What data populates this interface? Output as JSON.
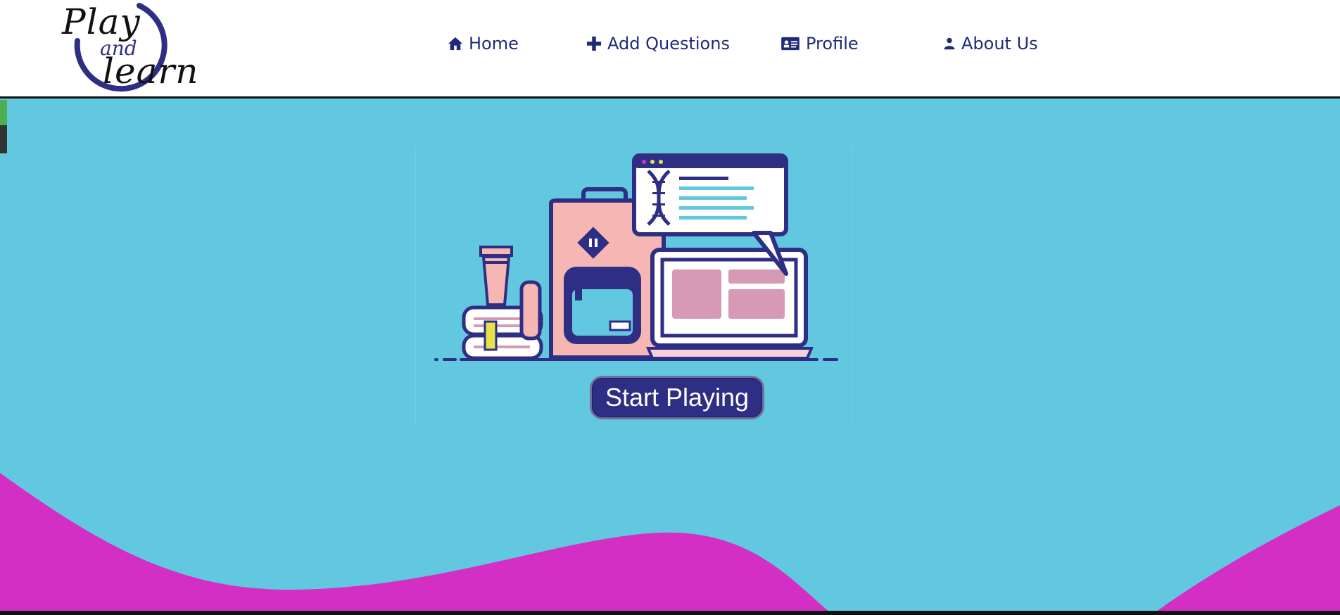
{
  "brand": {
    "logo_line1": "Play",
    "logo_line2": "and",
    "logo_line3": "learn"
  },
  "nav": {
    "items": [
      {
        "label": "Home",
        "icon": "home-icon"
      },
      {
        "label": "Add Questions",
        "icon": "plus-icon"
      },
      {
        "label": "Profile",
        "icon": "id-card-icon"
      },
      {
        "label": "About Us",
        "icon": "user-icon"
      }
    ]
  },
  "hero": {
    "cta_label": "Start Playing"
  },
  "colors": {
    "hero_bg": "#62c8df",
    "wave": "#d42fc4",
    "nav_text": "#1f2a7a",
    "button_bg": "#2e2e84"
  }
}
